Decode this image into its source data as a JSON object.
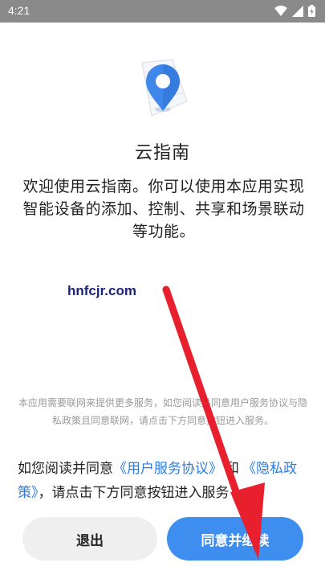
{
  "status_bar": {
    "time": "4:21",
    "icons": [
      "wifi-icon",
      "signal-icon",
      "battery-icon"
    ]
  },
  "app": {
    "icon": "location-pin-icon",
    "name": "云指南",
    "intro": "欢迎使用云指南。你可以使用本应用实现智能设备的添加、控制、共享和场景联动等功能。"
  },
  "watermark": "hnfcjr.com",
  "notice": "本应用需要联网来提供更多服务，如您阅读并同意用户服务协议与隐私政策且同意联网，请点击下方同意按钮进入服务。",
  "consent": {
    "prefix": "如您阅读并同意",
    "user_agreement": "《用户服务协议》",
    "and": "和",
    "privacy_policy": "《隐私政策》",
    "suffix": "，请点击下方同意按钮进入服务"
  },
  "buttons": {
    "exit": "退出",
    "agree": "同意并继续"
  },
  "colors": {
    "accent": "#3d8eee",
    "link": "#2f7de1",
    "arrow": "#e8202e",
    "status_bar": "#8a8a8a",
    "watermark": "#1a237e"
  }
}
